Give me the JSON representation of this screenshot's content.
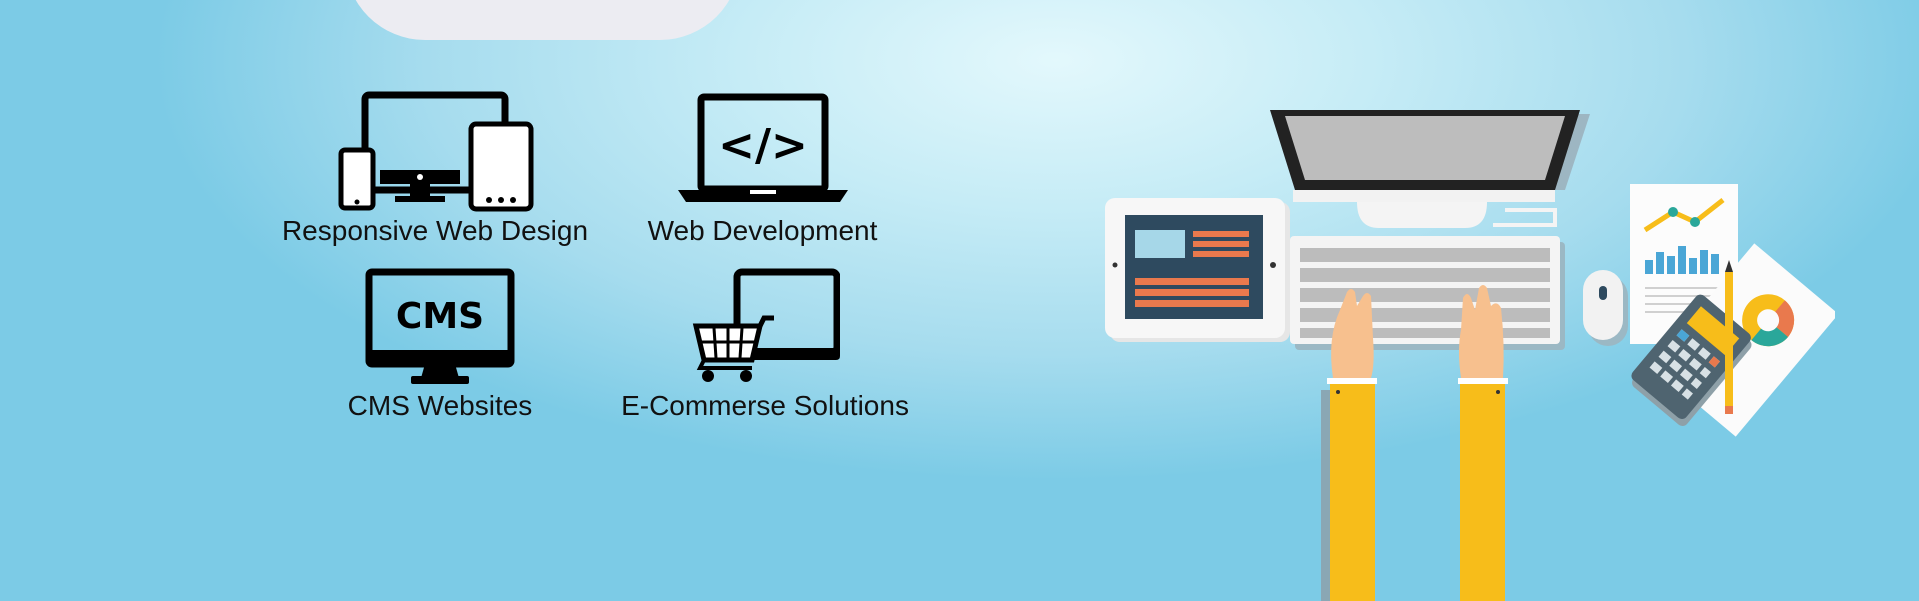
{
  "services": [
    {
      "label": "Responsive Web Design",
      "icon": "responsive-devices-icon"
    },
    {
      "label": "Web Development",
      "icon": "code-laptop-icon"
    },
    {
      "label": "CMS Websites",
      "icon": "cms-monitor-icon"
    },
    {
      "label": "E-Commerse Solutions",
      "icon": "shopping-cart-laptop-icon"
    }
  ],
  "cms_icon_text": "CMS",
  "code_icon_text": "</>",
  "colors": {
    "background": "#a6dcee",
    "sleeve": "#f7bd1a",
    "skin": "#f7c08e",
    "tablet_screen": "#2e4a5f",
    "accent_orange": "#e9794d"
  }
}
